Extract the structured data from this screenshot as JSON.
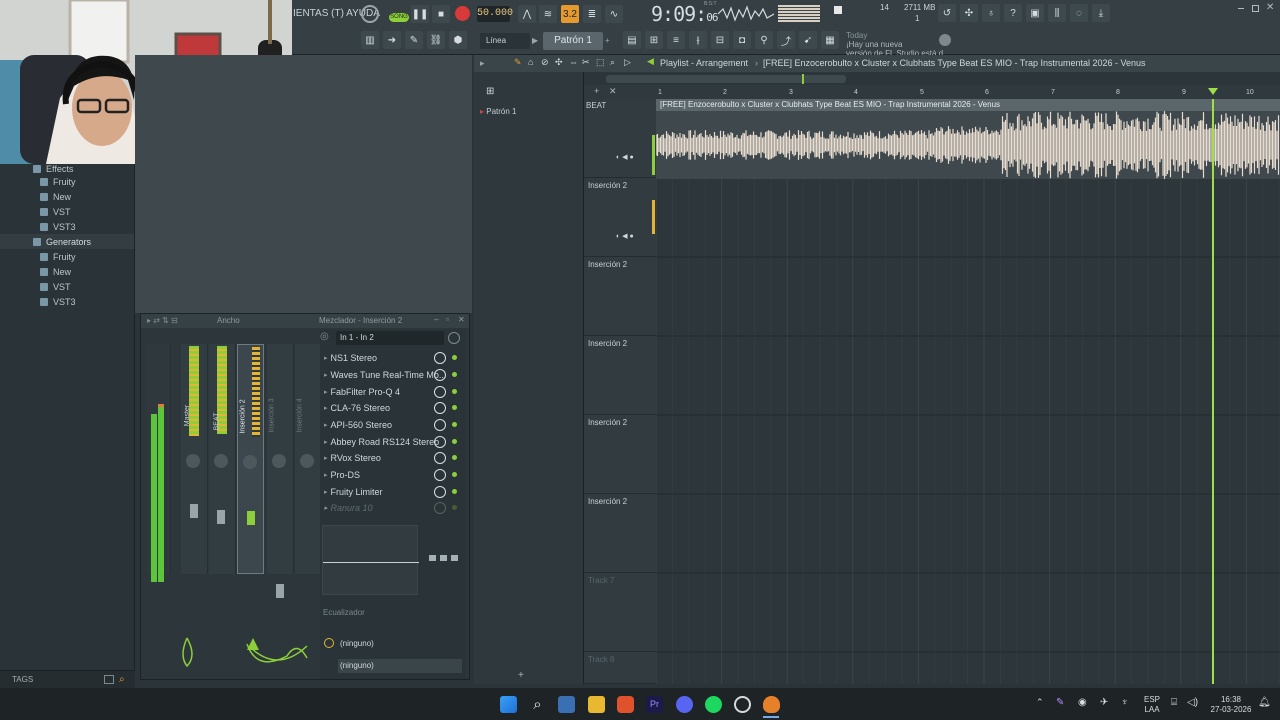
{
  "topbar": {
    "menu_text": "IENTAS (T) AYUDA",
    "song_label": "SONG",
    "tempo": "50.000",
    "pattern_label": "3.2",
    "time_main": "9:09",
    "time_sub": "06",
    "time_small_top": "B:S:T",
    "cpu_value": "14",
    "mem_value": "2711 MB",
    "mem_sub": "1",
    "snap_label": "Línea",
    "pattern_name": "Patrón 1",
    "hint_today": "Today",
    "hint_line1": "¡Hay una nueva",
    "hint_line2": "versión de FL Studio está d..."
  },
  "browser": {
    "items": [
      {
        "label": "Effects",
        "type": "folder"
      },
      {
        "label": "Fruity",
        "type": "item"
      },
      {
        "label": "New",
        "type": "item"
      },
      {
        "label": "VST",
        "type": "item"
      },
      {
        "label": "VST3",
        "type": "item"
      },
      {
        "label": "Generators",
        "type": "folder"
      },
      {
        "label": "Fruity",
        "type": "item"
      },
      {
        "label": "New",
        "type": "item"
      },
      {
        "label": "VST",
        "type": "item"
      },
      {
        "label": "VST3",
        "type": "item"
      }
    ],
    "tags_label": "TAGS"
  },
  "mixer": {
    "title": "Mezclador - Inserción 2",
    "view_label": "Ancho",
    "routing": "In 1 - In 2",
    "strips": [
      {
        "label": "Master"
      },
      {
        "label": "BEAT"
      },
      {
        "label": "Inserción 2"
      },
      {
        "label": "Inserción 3"
      },
      {
        "label": "Inserción 4"
      }
    ],
    "slots": [
      {
        "label": "NS1 Stereo"
      },
      {
        "label": "Waves Tune Real-Time Mo..."
      },
      {
        "label": "FabFilter Pro-Q 4"
      },
      {
        "label": "CLA-76 Stereo"
      },
      {
        "label": "API-560 Stereo"
      },
      {
        "label": "Abbey Road RS124 Stereo"
      },
      {
        "label": "RVox Stereo"
      },
      {
        "label": "Pro-DS"
      },
      {
        "label": "Fruity Limiter"
      },
      {
        "label": "Ranura 10"
      }
    ],
    "eq_label": "Ecualizador",
    "send1": "(ninguno)",
    "send2": "(ninguno)"
  },
  "picker": {
    "pattern": "Patrón 1"
  },
  "playlist": {
    "title": "Playlist - Arrangement",
    "arrangement": "[FREE] Enzocerobulto x Cluster x Clubhats Type Beat ES MIO - Trap Instrumental 2026 - Venus",
    "clip_title": "[FREE] Enzocerobulto x Cluster x Clubhats Type Beat ES MIO - Trap Instrumental 2026 - Venus",
    "ruler": [
      "1",
      "2",
      "3",
      "4",
      "5",
      "6",
      "7",
      "8",
      "9",
      "10"
    ],
    "tracks": [
      {
        "name": "BEAT"
      },
      {
        "name": "Inserción 2"
      },
      {
        "name": "Inserción 2"
      },
      {
        "name": "Inserción 2"
      },
      {
        "name": "Inserción 2"
      },
      {
        "name": "Inserción 2"
      },
      {
        "name": "Track 7"
      },
      {
        "name": "Track 8"
      }
    ]
  },
  "taskbar": {
    "lang_top": "ESP",
    "lang_bottom": "LAA",
    "clock_time": "16:38",
    "clock_date": "27-03-2026"
  },
  "colors": {
    "accent_green": "#8ccf3b",
    "accent_orange": "#e49a2c",
    "waveform": "#e8ddd0",
    "playhead": "#9fe04a"
  }
}
